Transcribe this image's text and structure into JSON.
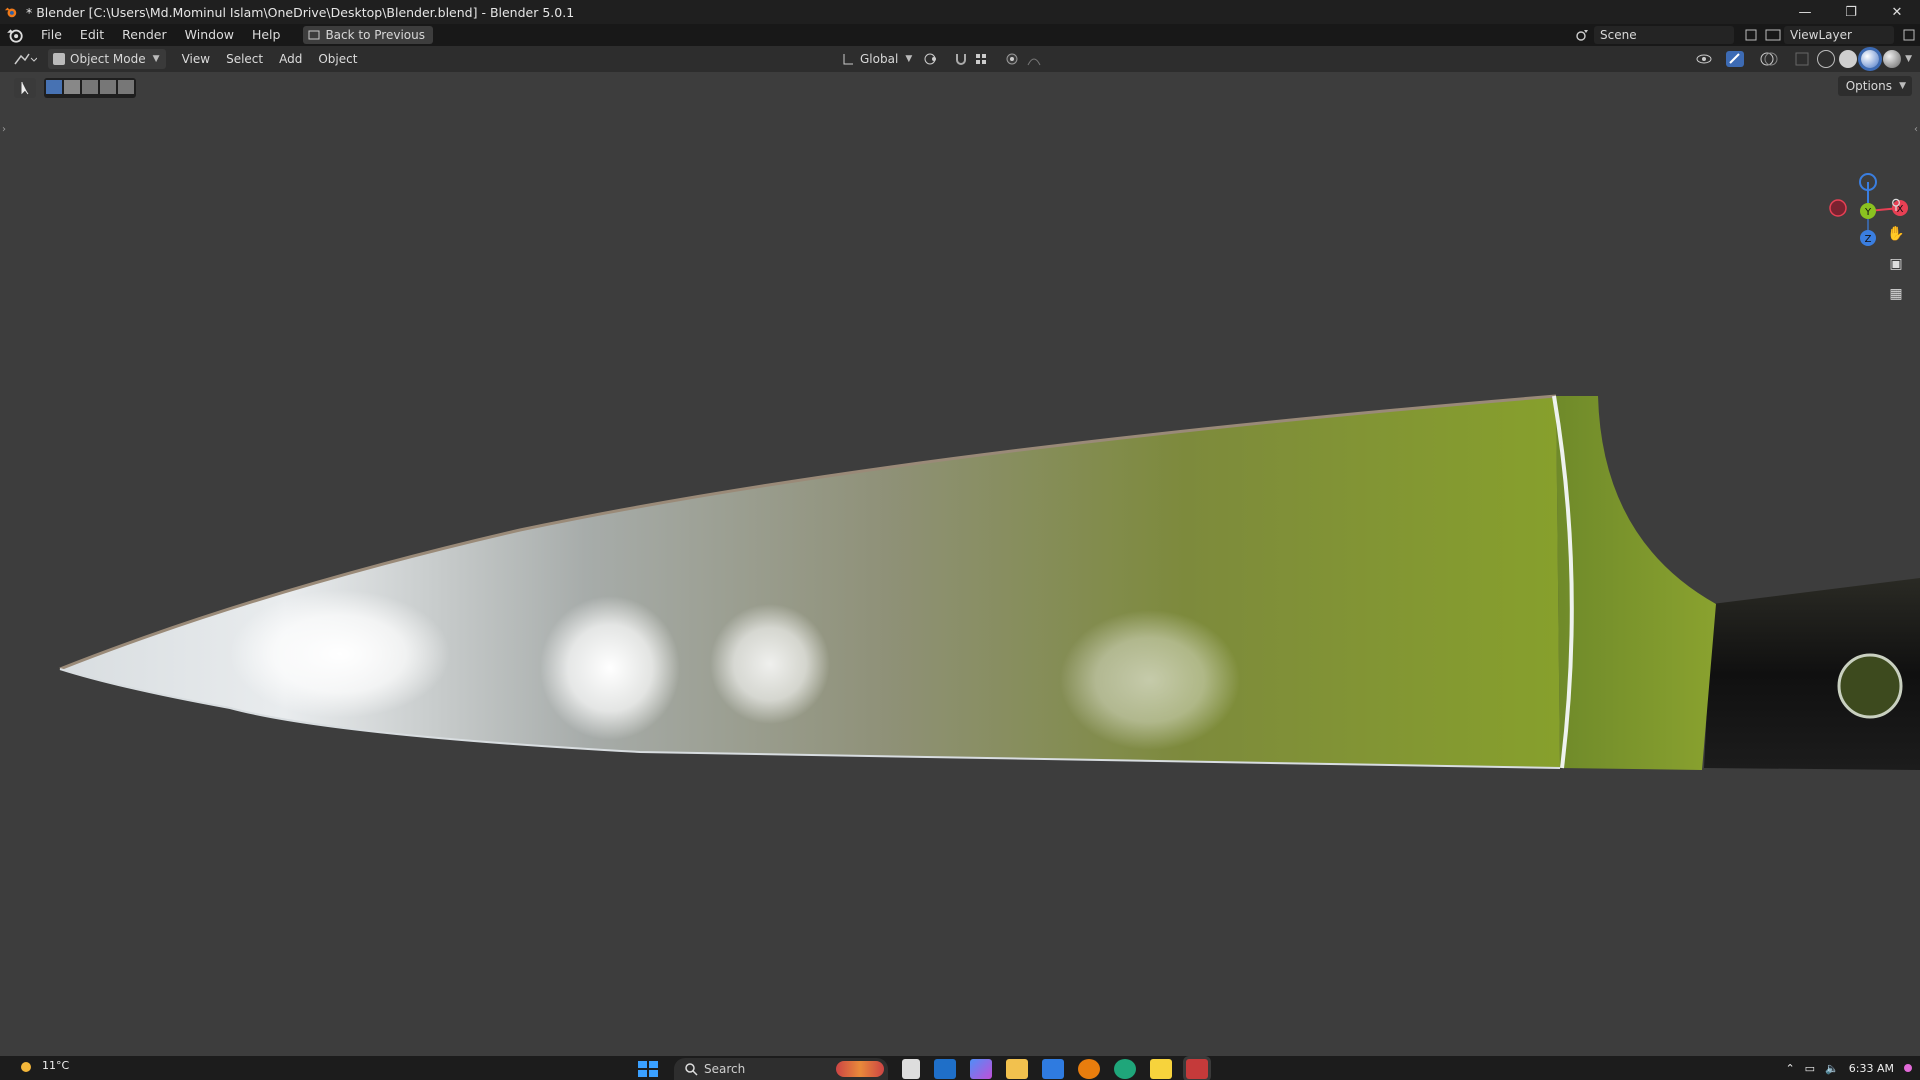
{
  "window": {
    "title": "* Blender [C:\\Users\\Md.Mominul Islam\\OneDrive\\Desktop\\Blender.blend] - Blender 5.0.1",
    "controls": [
      "minimize",
      "restore",
      "close"
    ]
  },
  "menubar": {
    "items": [
      "File",
      "Edit",
      "Render",
      "Window",
      "Help"
    ],
    "back_button": "Back to Previous",
    "scene": "Scene",
    "view_layer": "ViewLayer"
  },
  "viewport_header": {
    "mode": "Object Mode",
    "menus": [
      "View",
      "Select",
      "Add",
      "Object"
    ],
    "transform_orientation": "Global"
  },
  "tool_header": {
    "options": "Options"
  },
  "gizmo": {
    "axes": [
      "X",
      "Y",
      "Z"
    ],
    "colors": {
      "x": "#e84054",
      "y": "#8bc220",
      "z": "#3a7ee0"
    }
  },
  "taskbar": {
    "temperature": "11°C",
    "search_placeholder": "Search",
    "time": "6:33 AM"
  }
}
